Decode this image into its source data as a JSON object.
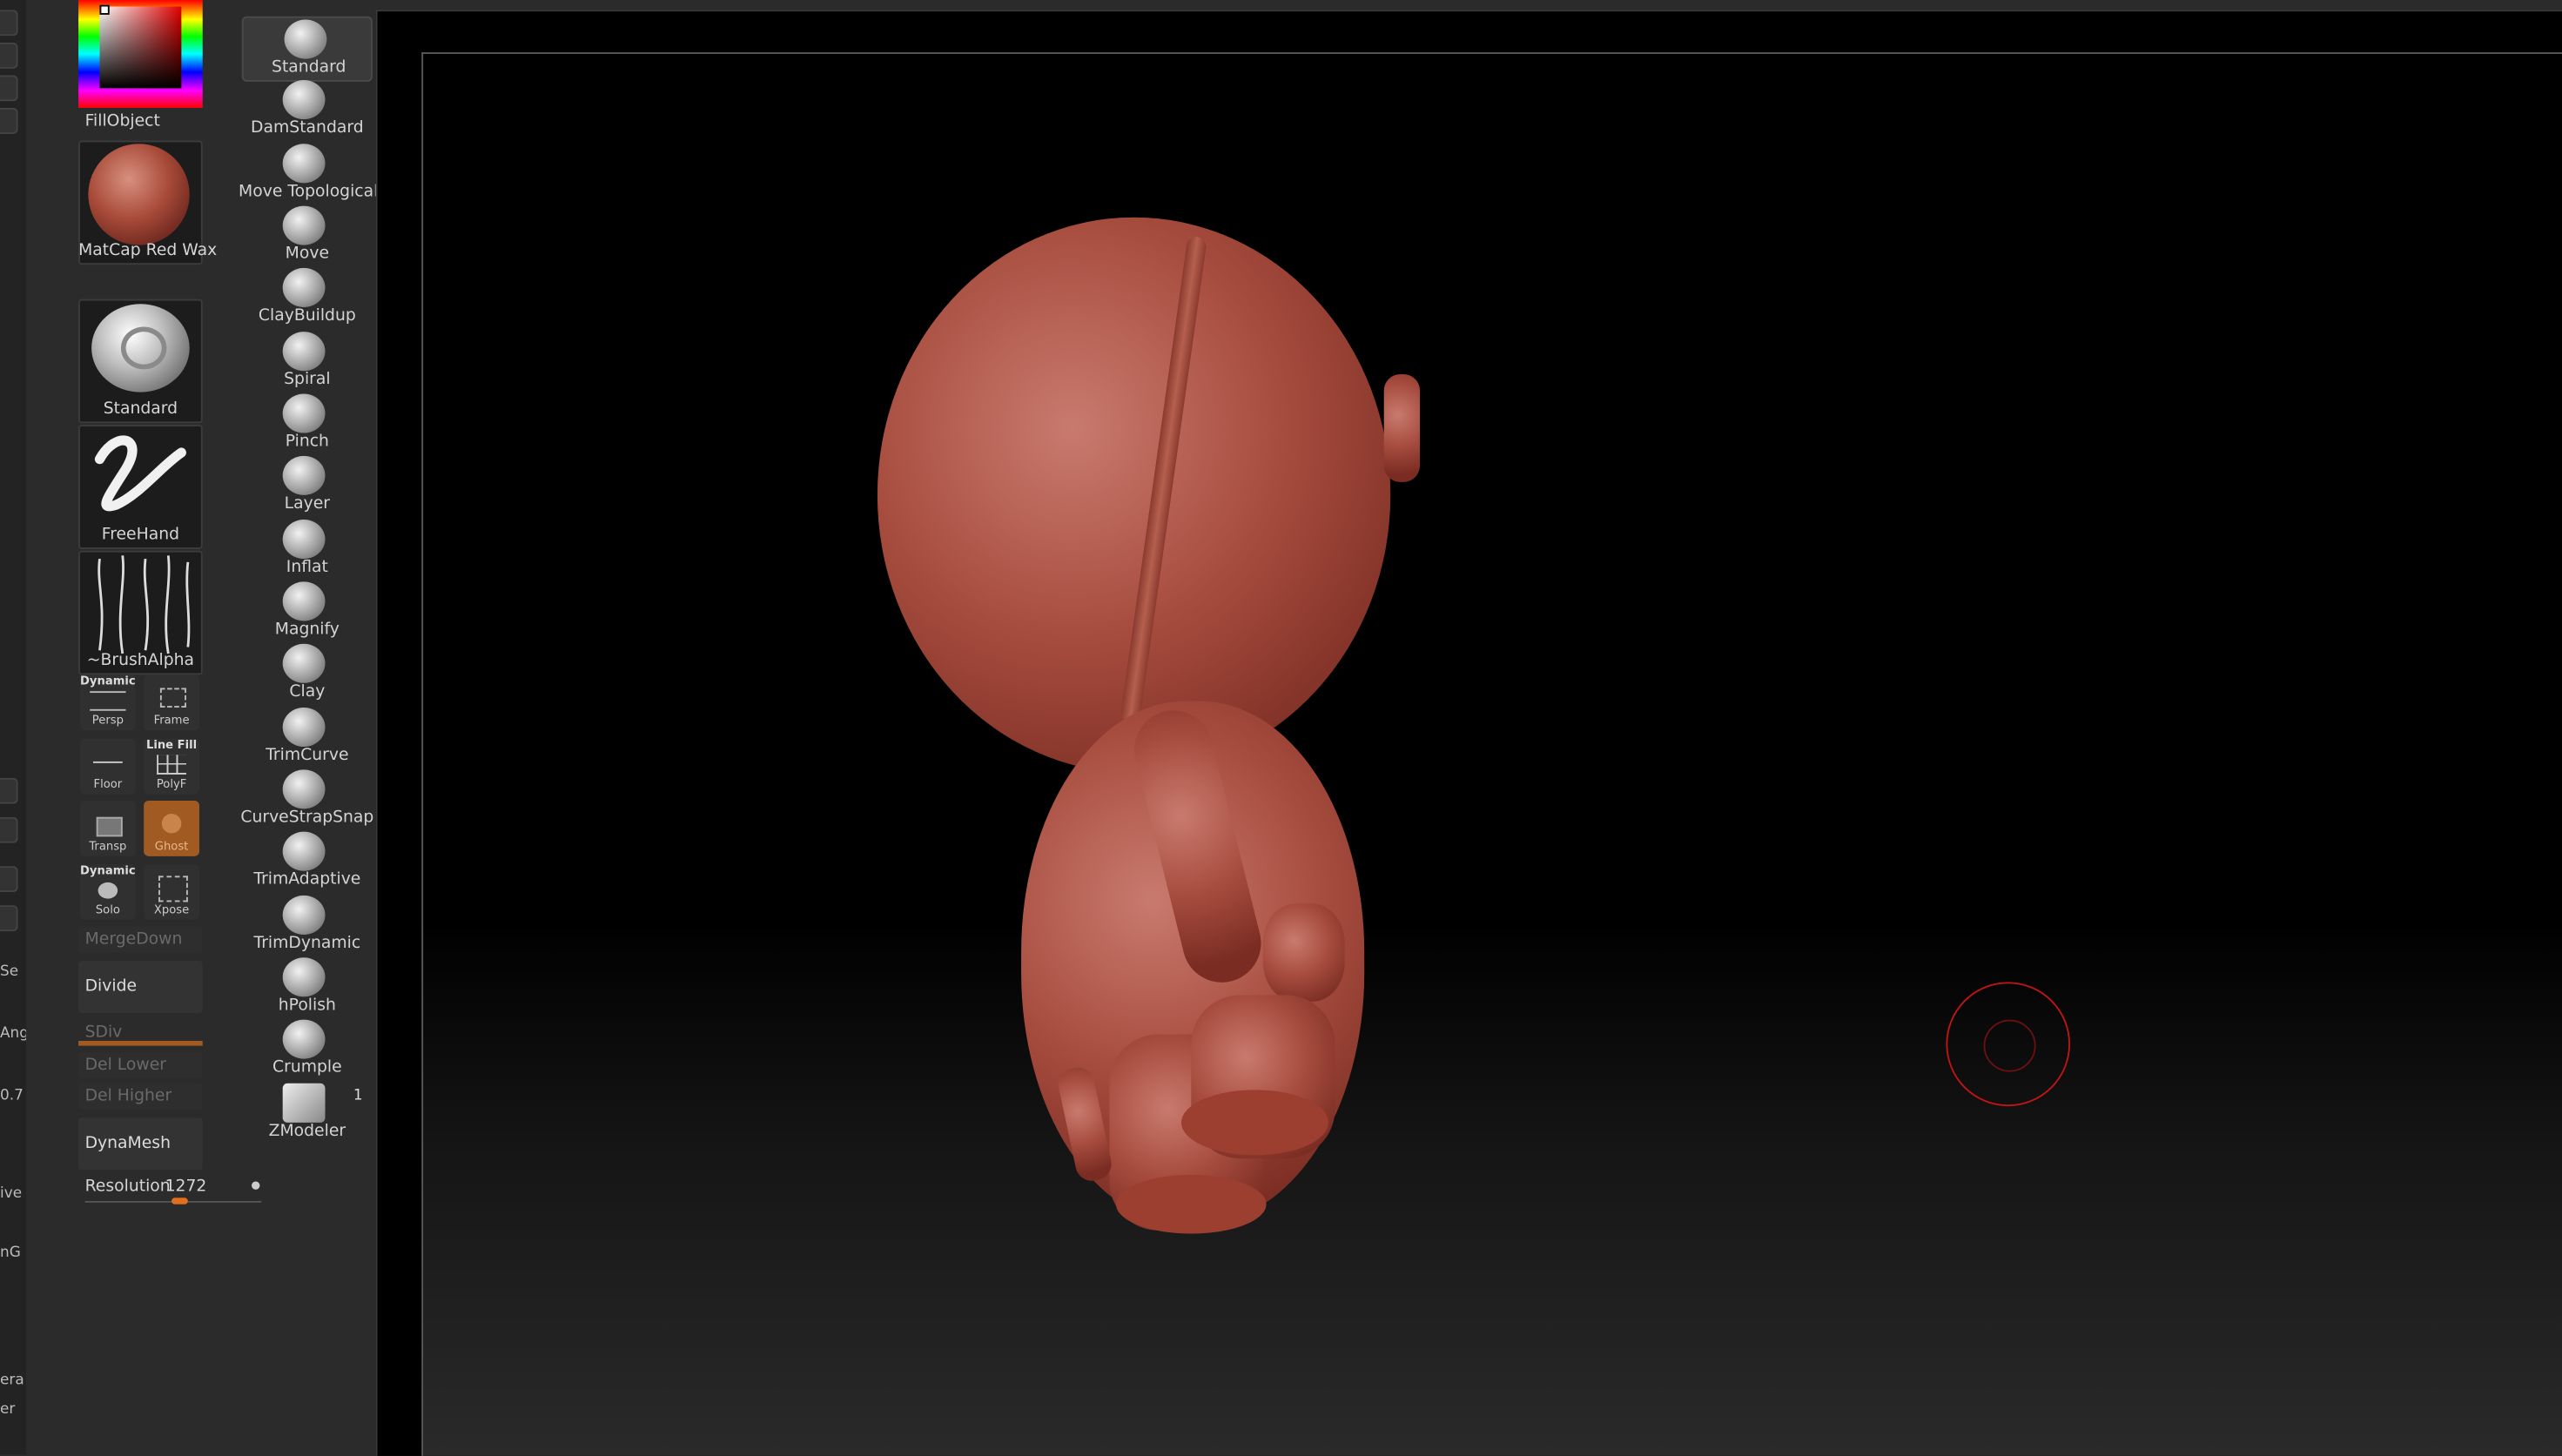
{
  "left_tray": {
    "labels": [
      "Se",
      "Ang",
      "0.7",
      "ive",
      "nG",
      "era",
      "er"
    ]
  },
  "material": {
    "fill_label": "FillObject",
    "material_name": "MatCap Red Wax"
  },
  "current_brush": {
    "brush_name": "Standard",
    "stroke_name": "FreeHand",
    "alpha_name": "~BrushAlpha"
  },
  "view_buttons": {
    "persp": {
      "top": "Dynamic",
      "label": "Persp"
    },
    "frame": {
      "label": "Frame"
    },
    "floor": {
      "label": "Floor"
    },
    "polyf": {
      "top": "Line Fill",
      "label": "PolyF"
    },
    "transp": {
      "label": "Transp"
    },
    "ghost": {
      "label": "Ghost"
    },
    "solo": {
      "top": "Dynamic",
      "label": "Solo"
    },
    "xpose": {
      "label": "Xpose"
    }
  },
  "geometry": {
    "merge_down": "MergeDown",
    "divide": "Divide",
    "sdiv": "SDiv",
    "del_lower": "Del Lower",
    "del_higher": "Del Higher",
    "dynamesh": "DynaMesh",
    "resolution_label": "Resolution",
    "resolution_value": "1272"
  },
  "brushes": [
    "Standard",
    "DamStandard",
    "Move Topological",
    "Move",
    "ClayBuildup",
    "Spiral",
    "Pinch",
    "Layer",
    "Inflat",
    "Magnify",
    "Clay",
    "TrimCurve",
    "CurveStrapSnap",
    "TrimAdaptive",
    "TrimDynamic",
    "hPolish",
    "Crumple",
    "ZModeler"
  ],
  "zmodeler_badge": "1",
  "colors": {
    "accent": "#e07020",
    "clay": "#a64c3e",
    "cursor": "#c01515"
  }
}
